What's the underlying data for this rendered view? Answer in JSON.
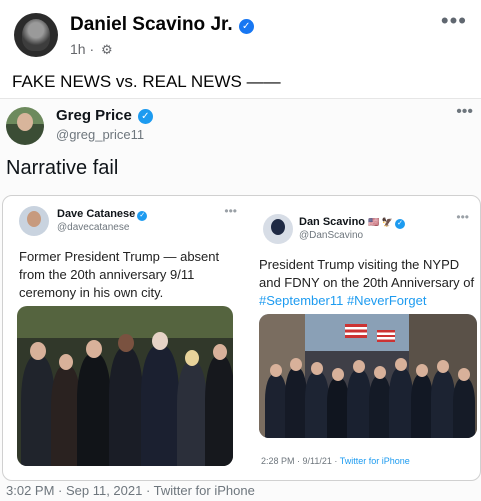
{
  "fb_post": {
    "author": "Daniel Scavino Jr.",
    "time": "1h",
    "separator": "·",
    "more": "•••",
    "text": "FAKE NEWS vs. REAL NEWS ——"
  },
  "embedded_tweet": {
    "author": "Greg Price",
    "handle": "@greg_price11",
    "more": "•••",
    "text": "Narrative fail",
    "timestamp": "3:02 PM · Sep 11, 2021 · Twitter for iPhone"
  },
  "left_card": {
    "author": "Dave Catanese",
    "handle": "@davecatanese",
    "more": "•••",
    "text": "Former President Trump — absent from the 20th anniversary 9/11 ceremony in his own city."
  },
  "right_card": {
    "author": "Dan Scavino",
    "author_flags": "🇺🇸 🦅",
    "handle": "@DanScavino",
    "more": "•••",
    "text_prefix": "President Trump visiting the NYPD and FDNY on the 20th Anniversary of ",
    "hashtag1": "#September11",
    "hashtag2": "#NeverForget",
    "time": "2:28 PM · 9/11/21 · ",
    "source": "Twitter for iPhone"
  },
  "colors": {
    "verified_blue": "#1877f2",
    "twitter_blue": "#1d9bf0",
    "muted_text": "#6e767d"
  }
}
